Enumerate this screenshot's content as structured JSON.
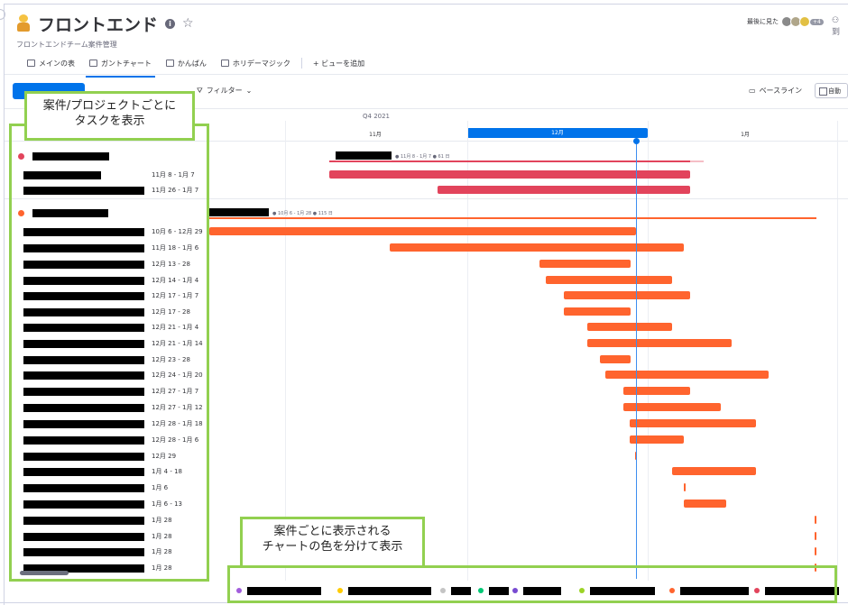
{
  "board": {
    "title": "フロントエンド",
    "subtitle": "フロントエンドチーム案件管理",
    "last_seen_label": "最後に見た",
    "last_seen_extra": "+4",
    "person_label": "到"
  },
  "tabs": [
    {
      "label": "メインの表",
      "icon": "table-icon"
    },
    {
      "label": "ガントチャート",
      "icon": "gantt-icon"
    },
    {
      "label": "かんばん",
      "icon": "kanban-icon"
    },
    {
      "label": "ホリデーマジック",
      "icon": "calendar-icon"
    }
  ],
  "add_view_label": "+ ビューを追加",
  "toolbar": {
    "filter_label": "フィルター",
    "baseline_label": "ベースライン",
    "auto_label": "自動"
  },
  "timeline": {
    "quarter_label": "Q4 2021",
    "months": [
      "11月",
      "12月",
      "1月"
    ],
    "current_month": "12月"
  },
  "groups": [
    {
      "color": "#e2445c",
      "summary": "● 11月 8 - 1月 7 ● 61 日",
      "items": [
        {
          "dates": "11月 8 - 1月 7"
        },
        {
          "dates": "11月 26 - 1月 7"
        }
      ]
    },
    {
      "color": "#ff642e",
      "summary": "● 10月 6 - 1月 28 ● 115 日",
      "items": [
        {
          "dates": "10月 6 - 12月 29"
        },
        {
          "dates": "11月 18 - 1月 6"
        },
        {
          "dates": "12月 13 - 28"
        },
        {
          "dates": "12月 14 - 1月 4"
        },
        {
          "dates": "12月 17 - 1月 7"
        },
        {
          "dates": "12月 17 - 28"
        },
        {
          "dates": "12月 21 - 1月 4"
        },
        {
          "dates": "12月 21 - 1月 14"
        },
        {
          "dates": "12月 23 - 28"
        },
        {
          "dates": "12月 24 - 1月 20"
        },
        {
          "dates": "12月 27 - 1月 7"
        },
        {
          "dates": "12月 27 - 1月 12"
        },
        {
          "dates": "12月 28 - 1月 18"
        },
        {
          "dates": "12月 28 - 1月 6"
        },
        {
          "dates": "12月 29"
        },
        {
          "dates": "1月 4 - 18"
        },
        {
          "dates": "1月 6"
        },
        {
          "dates": "1月 6 - 13"
        },
        {
          "dates": "1月 28"
        },
        {
          "dates": "1月 28"
        },
        {
          "dates": "1月 28"
        },
        {
          "dates": "1月 28"
        }
      ]
    }
  ],
  "legend_colors": [
    "#a25ddc",
    "#ffcb00",
    "#c4c4c4",
    "#00c875",
    "#784bd1",
    "#9cd326",
    "#ff642e",
    "#e2445c"
  ],
  "annotations": {
    "left_callout": "案件/プロジェクトごとに\nタスクを表示",
    "bottom_callout": "案件ごとに表示される\nチャートの色を分けて表示"
  }
}
